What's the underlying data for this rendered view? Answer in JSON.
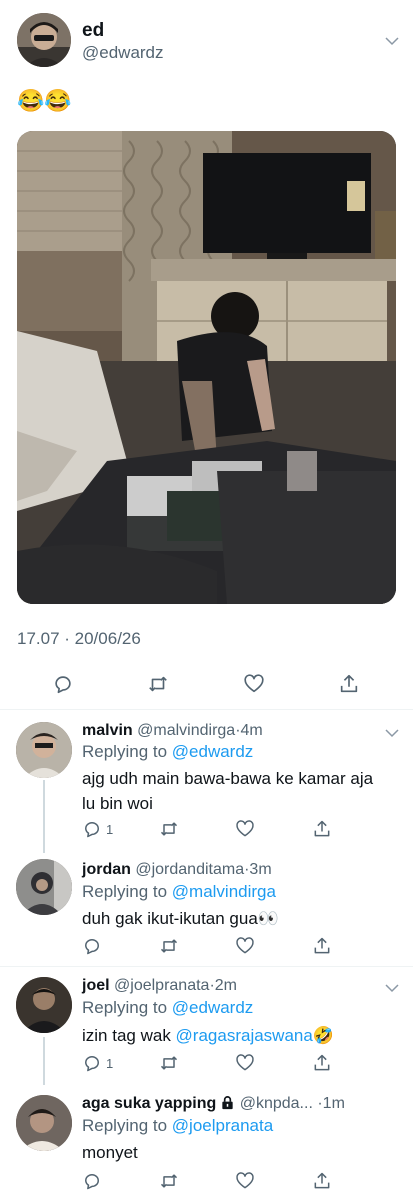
{
  "main_tweet": {
    "author_name": "ed",
    "author_handle": "@edwardz",
    "text": "😂😂",
    "timestamp": "17.07 · 20/06/26",
    "icons": [
      "reply-icon",
      "retweet-icon",
      "like-icon",
      "share-icon",
      "chevron-down-icon"
    ]
  },
  "replies": [
    {
      "name": "malvin",
      "handle": "@malvindirga",
      "time": "4m",
      "replying_prefix": "Replying to ",
      "replying_to": "@edwardz",
      "text_line1": "ajg udh main bawa-bawa ke kamar aja",
      "text_line2": "lu bin woi",
      "reply_count": "1"
    },
    {
      "name": "jordan",
      "handle": "@jordanditama",
      "time": "3m",
      "replying_prefix": "Replying to ",
      "replying_to": "@malvindirga",
      "text_line1": "duh gak ikut-ikutan gua👀",
      "reply_count": ""
    },
    {
      "name": "joel",
      "handle": "@joelpranata",
      "time": "2m",
      "replying_prefix": "Replying to ",
      "replying_to": "@edwardz",
      "text_before": "izin tag wak ",
      "text_mention": "@ragasrajaswana",
      "text_after": "🤣",
      "reply_count": "1"
    },
    {
      "name": "aga suka yapping",
      "handle": "@knpda...",
      "time": "1m",
      "replying_prefix": "Replying to ",
      "replying_to": "@joelpranata",
      "text_line1": "monyet",
      "reply_count": "",
      "protected_icon": "lock-icon"
    }
  ],
  "colors": {
    "text": "#0f1419",
    "secondary": "#536471",
    "link": "#1d9bf0",
    "divider": "#eff3f4",
    "thread_line": "#cfd9de"
  }
}
